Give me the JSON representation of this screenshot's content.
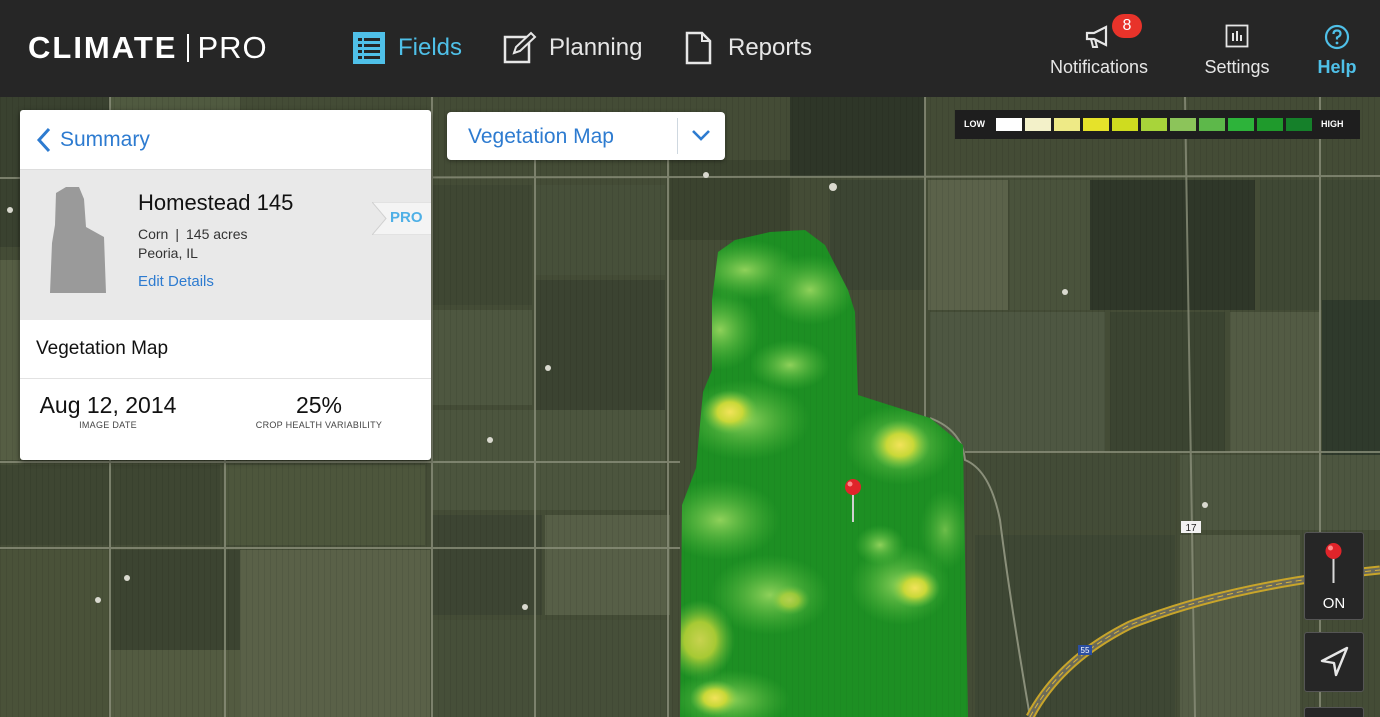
{
  "app": {
    "logo_left": "CLIMATE",
    "logo_right": "PRO"
  },
  "nav": {
    "tabs": [
      {
        "label": "Fields",
        "icon": "list-icon",
        "active": true
      },
      {
        "label": "Planning",
        "icon": "edit-icon",
        "active": false
      },
      {
        "label": "Reports",
        "icon": "document-icon",
        "active": false
      }
    ],
    "notifications": {
      "label": "Notifications",
      "count": "8",
      "icon": "megaphone-icon"
    },
    "settings": {
      "label": "Settings",
      "icon": "settings-icon"
    },
    "help": {
      "label": "Help",
      "icon": "help-icon"
    },
    "accent_color": "#4fc0e8"
  },
  "panel": {
    "back_label": "Summary",
    "field": {
      "name": "Homestead 145",
      "crop": "Corn",
      "separator": "|",
      "acres": "145 acres",
      "location": "Peoria, IL",
      "edit_label": "Edit Details",
      "tag": "PRO"
    },
    "section_title": "Vegetation Map",
    "stats": {
      "date_value": "Aug 12, 2014",
      "date_caption": "IMAGE DATE",
      "variability_value": "25%",
      "variability_caption": "CROP HEALTH VARIABILITY"
    }
  },
  "layer_select": {
    "selected": "Vegetation Map"
  },
  "legend": {
    "low_label": "LOW",
    "high_label": "HIGH",
    "colors": [
      "#ffffff",
      "#f3f1c9",
      "#eeea86",
      "#e6e22a",
      "#cfdc1f",
      "#a8d43a",
      "#8cc45a",
      "#5db84a",
      "#2db33a",
      "#1f9a2c",
      "#15802a"
    ]
  },
  "map": {
    "highway_label": "55",
    "route_label": "17"
  },
  "controls": {
    "pin_toggle_label": "ON"
  }
}
